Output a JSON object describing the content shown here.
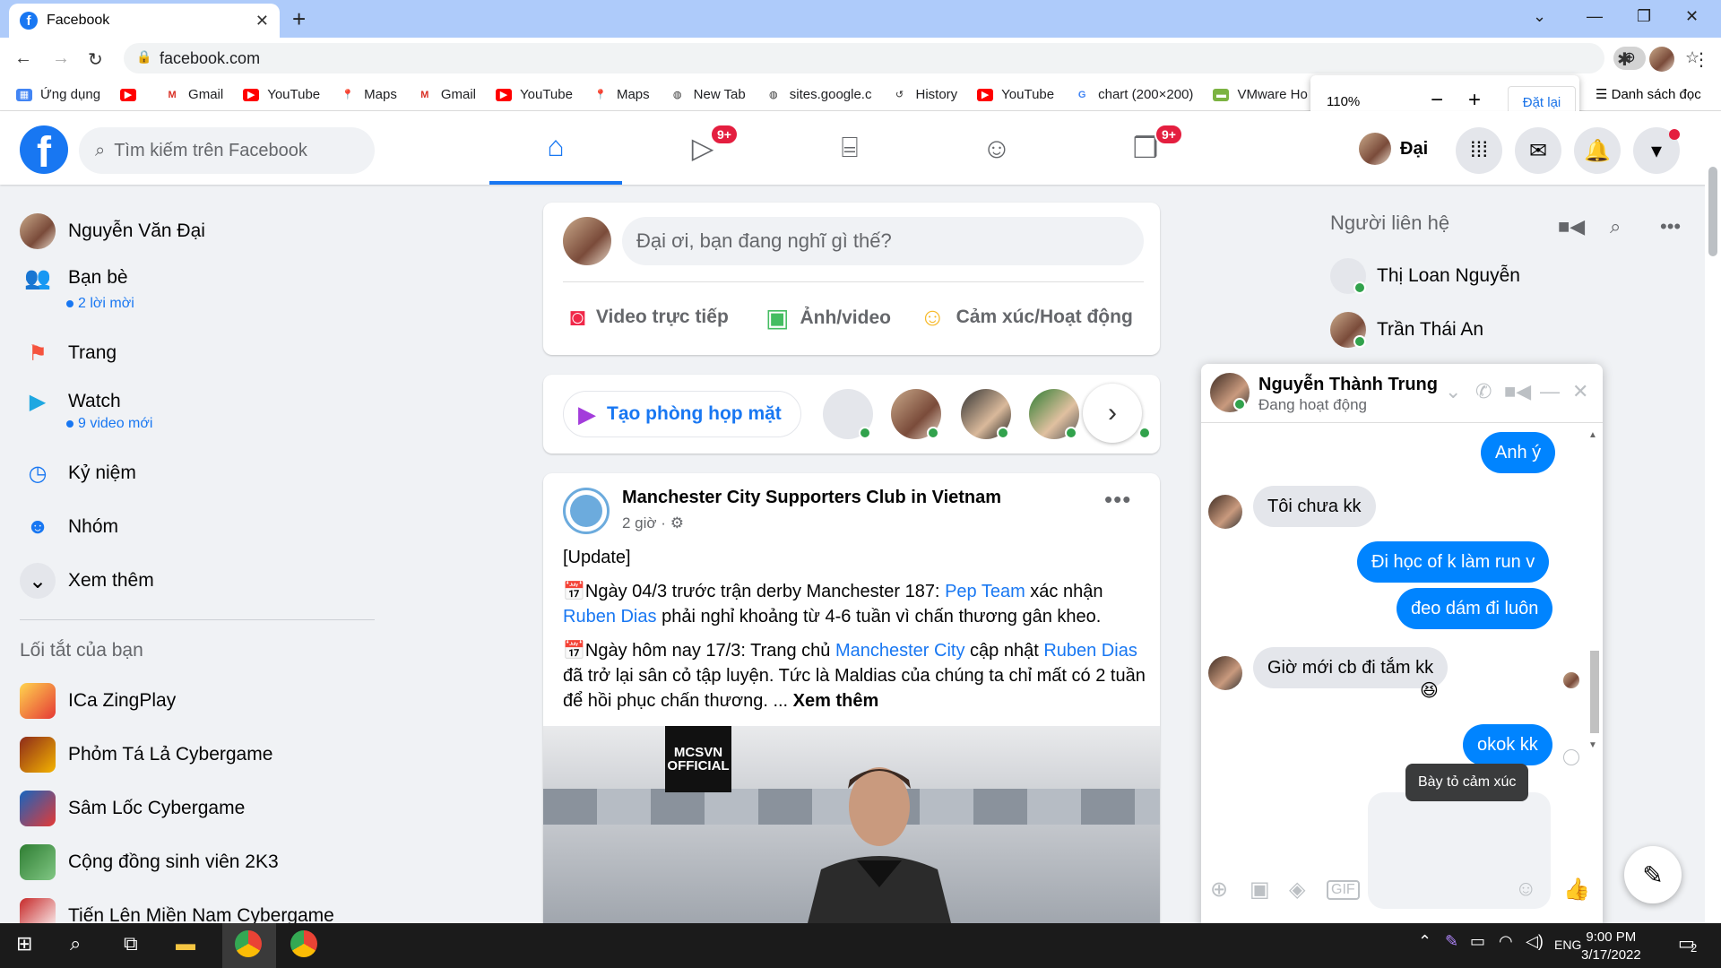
{
  "browser": {
    "tab_title": "Facebook",
    "url": "facebook.com",
    "zoom": {
      "value": "110%",
      "reset_label": "Đặt lại"
    },
    "bookmarks": [
      {
        "label": "Ứng dụng",
        "icon": "apps-grid-icon"
      },
      {
        "label": "",
        "icon": "youtube-icon"
      },
      {
        "label": "Gmail",
        "icon": "gmail-icon"
      },
      {
        "label": "YouTube",
        "icon": "youtube-icon"
      },
      {
        "label": "Maps",
        "icon": "maps-icon"
      },
      {
        "label": "Gmail",
        "icon": "gmail-icon"
      },
      {
        "label": "YouTube",
        "icon": "youtube-icon"
      },
      {
        "label": "Maps",
        "icon": "maps-icon"
      },
      {
        "label": "New Tab",
        "icon": "globe-icon"
      },
      {
        "label": "sites.google.c",
        "icon": "globe-icon"
      },
      {
        "label": "History",
        "icon": "history-icon"
      },
      {
        "label": "YouTube",
        "icon": "youtube-icon"
      },
      {
        "label": "chart (200×200)",
        "icon": "google-icon"
      },
      {
        "label": "VMware Ho",
        "icon": "vmware-icon"
      }
    ],
    "reading_list": "Danh sách đọc"
  },
  "fb": {
    "search_placeholder": "Tìm kiếm trên Facebook",
    "nav_badges": {
      "watch": "9+",
      "gaming": "9+"
    },
    "profile_short": "Đại",
    "left": {
      "profile": "Nguyễn Văn Đại",
      "friends": "Bạn bè",
      "friends_sub": "2 lời mời",
      "pages": "Trang",
      "watch": "Watch",
      "watch_sub": "9 video mới",
      "memories": "Kỷ niệm",
      "groups": "Nhóm",
      "see_more": "Xem thêm",
      "shortcuts_title": "Lối tắt của bạn",
      "shortcuts": [
        "ICa ZingPlay",
        "Phỏm Tá Lả Cybergame",
        "Sâm Lốc Cybergame",
        "Cộng đồng sinh viên 2K3",
        "Tiến Lên Miền Nam Cybergame"
      ]
    },
    "composer": {
      "placeholder": "Đại ơi, bạn đang nghĩ gì thế?",
      "live": "Video trực tiếp",
      "photo": "Ảnh/video",
      "feeling": "Cảm xúc/Hoạt động"
    },
    "rooms": {
      "create": "Tạo phòng họp mặt"
    },
    "post": {
      "author": "Manchester City Supporters Club in Vietnam",
      "time": "2 giờ ·",
      "line1": "[Update]",
      "p1_a": "Ngày 04/3 trước trận derby Manchester 187: ",
      "p1_link1": "Pep Team",
      "p1_b": " xác nhận ",
      "p1_link2": "Ruben Dias",
      "p1_c": " phải nghỉ khoảng từ 4-6 tuần vì chấn thương gân kheo.",
      "p2_a": "Ngày hôm nay 17/3: Trang chủ ",
      "p2_link1": "Manchester City",
      "p2_b": " cập nhật ",
      "p2_link2": "Ruben Dias",
      "p2_c": " đã trở lại sân cỏ tập luyện. Tức là Maldias của chúng ta chỉ mất có 2 tuần để hồi phục chấn thương. ... ",
      "see_more": "Xem thêm",
      "image_logo": "MCSVN OFFICIAL"
    },
    "contacts": {
      "title": "Người liên hệ",
      "items": [
        "Thị Loan Nguyễn",
        "Trần Thái An"
      ]
    },
    "chat": {
      "name": "Nguyễn Thành Trung",
      "status": "Đang hoạt động",
      "messages": [
        {
          "dir": "out",
          "text": "Anh ý"
        },
        {
          "dir": "in",
          "text": "Tôi chưa kk"
        },
        {
          "dir": "out",
          "text": "Đi học of k làm run v"
        },
        {
          "dir": "out",
          "text": "đeo dám đi luôn"
        },
        {
          "dir": "in",
          "text": "Giờ mới cb đi tắm kk"
        },
        {
          "dir": "out",
          "text": "okok kk"
        }
      ],
      "tooltip": "Bày tỏ cảm xúc"
    }
  },
  "taskbar": {
    "lang": "ENG",
    "time": "9:00 PM",
    "date": "3/17/2022",
    "notif_count": "2"
  }
}
